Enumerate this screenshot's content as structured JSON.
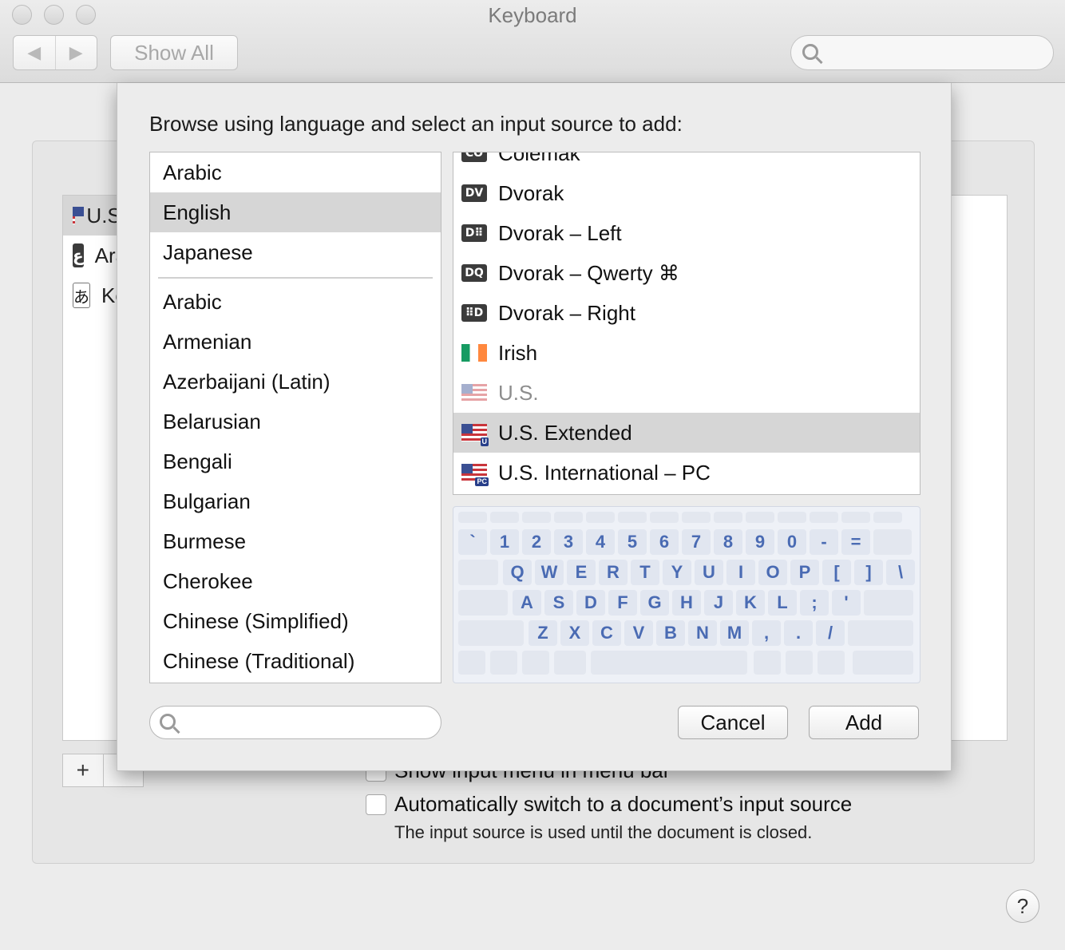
{
  "window": {
    "title": "Keyboard",
    "show_all": "Show All"
  },
  "background": {
    "sources": [
      {
        "label": "U.S.",
        "icon": "us-flag-icon"
      },
      {
        "label": "Arabic",
        "icon": "arabic-letter-icon",
        "glyph": "ع"
      },
      {
        "label": "Kotoeri",
        "icon": "hiragana-icon",
        "glyph": "あ"
      }
    ],
    "plus": "+",
    "minus": "−",
    "show_input_menu": "Show input menu in menu bar",
    "auto_switch": "Automatically switch to a document’s input source",
    "auto_switch_note": "The input source is used until the document is closed.",
    "help": "?"
  },
  "sheet": {
    "prompt": "Browse using language and select an input source to add:",
    "languages_top": [
      "Arabic",
      "English",
      "Japanese"
    ],
    "languages_all": [
      "Arabic",
      "Armenian",
      "Azerbaijani (Latin)",
      "Belarusian",
      "Bengali",
      "Bulgarian",
      "Burmese",
      "Cherokee",
      "Chinese (Simplified)",
      "Chinese (Traditional)"
    ],
    "selected_language": "English",
    "sources": [
      {
        "label": "Colemak",
        "badge": "CO"
      },
      {
        "label": "Dvorak",
        "badge": "DV"
      },
      {
        "label": "Dvorak – Left",
        "badge": "D⠿"
      },
      {
        "label": "Dvorak – Qwerty ⌘",
        "badge": "DQ"
      },
      {
        "label": "Dvorak – Right",
        "badge": "⠿D"
      },
      {
        "label": "Irish",
        "badge": ""
      },
      {
        "label": "U.S.",
        "badge": ""
      },
      {
        "label": "U.S. Extended",
        "badge": "U"
      },
      {
        "label": "U.S. International – PC",
        "badge": "PC"
      }
    ],
    "selected_source": "U.S. Extended",
    "keyboard_rows": [
      [
        "`",
        "1",
        "2",
        "3",
        "4",
        "5",
        "6",
        "7",
        "8",
        "9",
        "0",
        "-",
        "="
      ],
      [
        "Q",
        "W",
        "E",
        "R",
        "T",
        "Y",
        "U",
        "I",
        "O",
        "P",
        "[",
        "]",
        "\\"
      ],
      [
        "A",
        "S",
        "D",
        "F",
        "G",
        "H",
        "J",
        "K",
        "L",
        ";",
        "'"
      ],
      [
        "Z",
        "X",
        "C",
        "V",
        "B",
        "N",
        "M",
        ",",
        ".",
        "/"
      ]
    ],
    "search_placeholder": "",
    "cancel": "Cancel",
    "add": "Add"
  }
}
